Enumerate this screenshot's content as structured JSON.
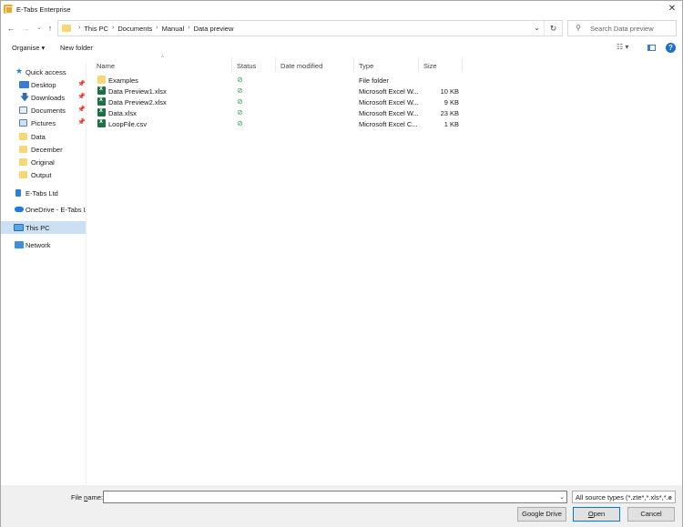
{
  "window": {
    "title": "E-Tabs Enterprise",
    "close_glyph": "✕"
  },
  "nav": {
    "back_glyph": "←",
    "forward_glyph": "→",
    "recent_glyph": "⌄",
    "up_glyph": "↑",
    "address_crumbs": [
      "This PC",
      "Documents",
      "Manual",
      "Data preview"
    ],
    "crumb_separator": "›",
    "address_dropdown_glyph": "⌄",
    "refresh_glyph": "↻",
    "search_placeholder": "Search Data preview",
    "search_glyph": "⚲"
  },
  "commandbar": {
    "organise": "Organise ▾",
    "new_folder": "New folder",
    "view_glyph": "☷ ▾",
    "help_glyph": "?"
  },
  "sidebar": {
    "items": [
      {
        "label": "Quick access",
        "icon": "star-icon",
        "pinned": false
      },
      {
        "label": "Desktop",
        "icon": "desktop-icon",
        "pinned": true
      },
      {
        "label": "Downloads",
        "icon": "downloads-icon",
        "pinned": true
      },
      {
        "label": "Documents",
        "icon": "documents-icon",
        "pinned": true
      },
      {
        "label": "Pictures",
        "icon": "pictures-icon",
        "pinned": true
      },
      {
        "label": "Data",
        "icon": "folder-icon",
        "pinned": false
      },
      {
        "label": "December",
        "icon": "folder-icon",
        "pinned": false
      },
      {
        "label": "Original",
        "icon": "folder-icon",
        "pinned": false
      },
      {
        "label": "Output",
        "icon": "folder-icon",
        "pinned": false
      },
      {
        "label": "E-Tabs Ltd",
        "icon": "organization-icon",
        "pinned": false
      },
      {
        "label": "OneDrive - E-Tabs Ltd",
        "icon": "onedrive-icon",
        "pinned": false
      },
      {
        "label": "This PC",
        "icon": "this-pc-icon",
        "pinned": false,
        "selected": true
      },
      {
        "label": "Network",
        "icon": "network-icon",
        "pinned": false
      }
    ],
    "pin_glyph": "📌"
  },
  "filelist": {
    "columns": [
      "Name",
      "Status",
      "Date modified",
      "Type",
      "Size"
    ],
    "sort_glyph": "^",
    "status_glyph": "⊘",
    "rows": [
      {
        "name": "Examples",
        "kind": "folder",
        "status": "⊘",
        "date": "",
        "type": "File folder",
        "size": ""
      },
      {
        "name": "Data Preview1.xlsx",
        "kind": "xls",
        "status": "⊘",
        "date": "",
        "type": "Microsoft Excel W...",
        "size": "10 KB"
      },
      {
        "name": "Data Preview2.xlsx",
        "kind": "xls",
        "status": "⊘",
        "date": "",
        "type": "Microsoft Excel W...",
        "size": "9 KB"
      },
      {
        "name": "Data.xlsx",
        "kind": "xls",
        "status": "⊘",
        "date": "",
        "type": "Microsoft Excel W...",
        "size": "23 KB"
      },
      {
        "name": "LoopFile.csv",
        "kind": "csv",
        "status": "⊘",
        "date": "",
        "type": "Microsoft Excel C...",
        "size": "1 KB"
      }
    ]
  },
  "footer": {
    "filename_label_pre": "File ",
    "filename_label_u": "n",
    "filename_label_post": "ame:",
    "filename_value": "",
    "dropdown_glyph": "⌄",
    "file_type": "All source types (*.zte*,*.xls*,*.e",
    "google_drive": "Google Drive",
    "open_u": "O",
    "open_rest": "pen",
    "cancel": "Cancel"
  }
}
